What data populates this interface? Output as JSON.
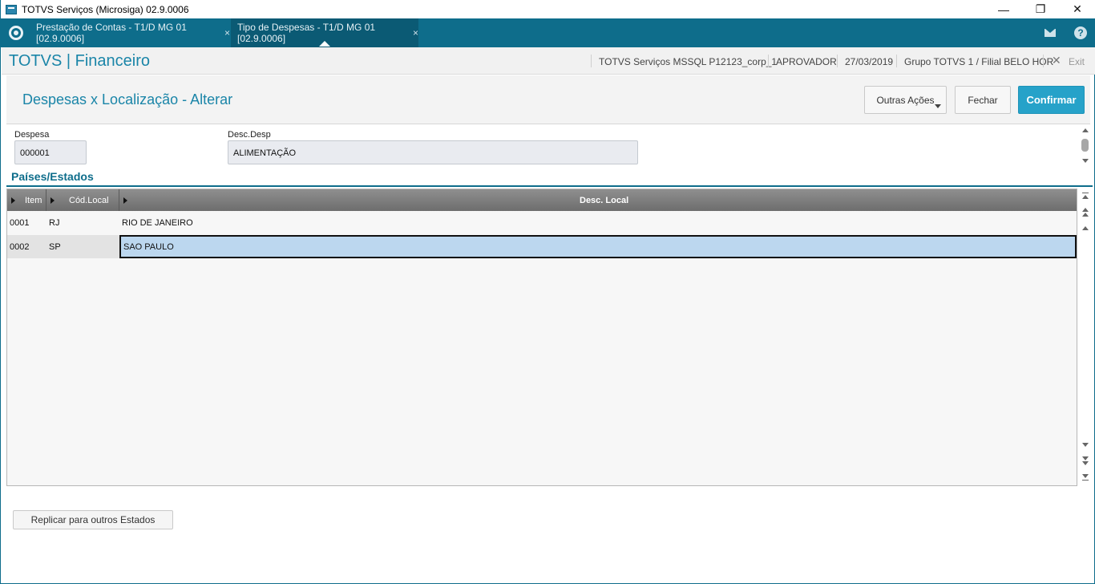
{
  "window": {
    "title": "TOTVS Serviços (Microsiga) 02.9.0006",
    "controls": {
      "minimize": "—",
      "restore": "❐",
      "close": "✕"
    }
  },
  "tabs": [
    {
      "label": "Prestação de Contas - T1/D MG 01  [02.9.0006]",
      "close": "×",
      "active": false
    },
    {
      "label": "Tipo de Despesas - T1/D MG 01  [02.9.0006]",
      "close": "×",
      "active": true
    }
  ],
  "topbar_icons": {
    "mail": "mail-icon",
    "help": "help-icon",
    "help_glyph": "?"
  },
  "header": {
    "module": "TOTVS | Financeiro",
    "environment": "TOTVS Serviços MSSQL P12123_corp_1",
    "user": "APROVADOR",
    "date": "27/03/2019",
    "branch": "Grupo TOTVS 1 / Filial BELO HOR",
    "exit_label": "Exit",
    "exit_glyph": "✕"
  },
  "form": {
    "title": "Despesas x Localização - Alterar",
    "buttons": {
      "other_actions": "Outras Ações",
      "close": "Fechar",
      "confirm": "Confirmar"
    },
    "fields": {
      "despesa": {
        "label": "Despesa",
        "value": "000001"
      },
      "desc_desp": {
        "label": "Desc.Desp",
        "value": "ALIMENTAÇÃO"
      }
    }
  },
  "section": {
    "title": "Países/Estados"
  },
  "grid": {
    "columns": [
      "Item",
      "Cód.Local",
      "Desc. Local"
    ],
    "rows": [
      {
        "item": "0001",
        "cod": "RJ",
        "desc": "RIO DE JANEIRO",
        "selected": false
      },
      {
        "item": "0002",
        "cod": "SP",
        "desc": "SAO PAULO",
        "selected": true
      }
    ]
  },
  "footer": {
    "replicate_button": "Replicar para outros  Estados"
  },
  "colors": {
    "brand_dark": "#0e6d8b",
    "accent": "#1a85a8",
    "primary_button": "#26a2c9",
    "selection": "#bcd7ef"
  }
}
